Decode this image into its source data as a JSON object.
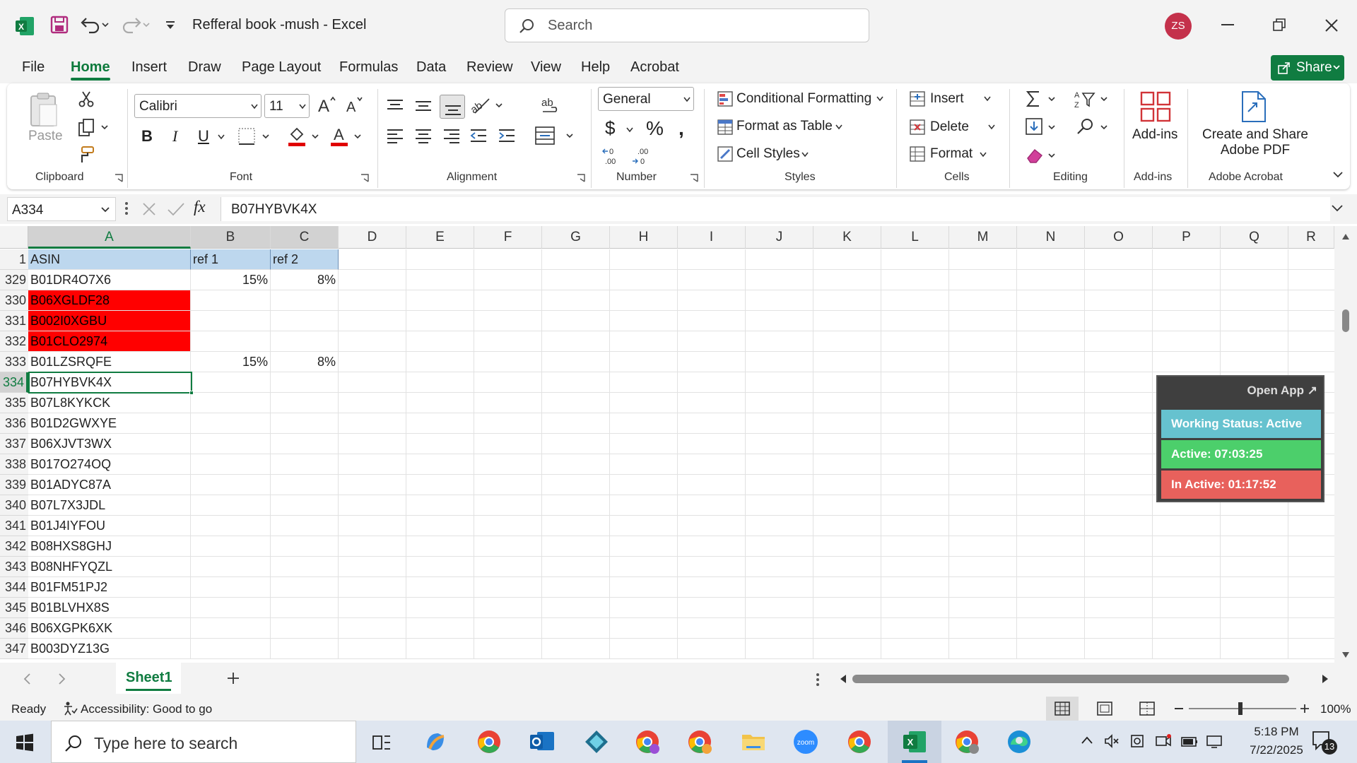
{
  "titlebar": {
    "doc_title": "Refferal book -mush  -  Excel",
    "search_placeholder": "Search",
    "avatar_initials": "ZS"
  },
  "tabs": [
    "File",
    "Home",
    "Insert",
    "Draw",
    "Page Layout",
    "Formulas",
    "Data",
    "Review",
    "View",
    "Help",
    "Acrobat"
  ],
  "share_label": "Share",
  "ribbon": {
    "clipboard": {
      "paste": "Paste",
      "group": "Clipboard"
    },
    "font": {
      "name": "Calibri",
      "size": "11",
      "group": "Font"
    },
    "alignment": {
      "group": "Alignment"
    },
    "number": {
      "format": "General",
      "group": "Number"
    },
    "styles": {
      "conditional": "Conditional Formatting",
      "table": "Format as Table",
      "cell": "Cell Styles",
      "group": "Styles"
    },
    "cells": {
      "insert": "Insert",
      "delete": "Delete",
      "format": "Format",
      "group": "Cells"
    },
    "editing": {
      "group": "Editing"
    },
    "addins": {
      "label": "Add-ins",
      "group": "Add-ins"
    },
    "acrobat": {
      "line1": "Create and Share",
      "line2": "Adobe PDF",
      "group": "Adobe Acrobat"
    }
  },
  "formula": {
    "namebox": "A334",
    "fx": "fx",
    "value": "B07HYBVK4X"
  },
  "columns": [
    "A",
    "B",
    "C",
    "D",
    "E",
    "F",
    "G",
    "H",
    "I",
    "J",
    "K",
    "L",
    "M",
    "N",
    "O",
    "P",
    "Q",
    "R"
  ],
  "header_row": {
    "num": "1",
    "a": "ASIN",
    "b": "ref 1",
    "c": "ref 2"
  },
  "rows": [
    {
      "num": "329",
      "a": "B01DR4O7X6",
      "b": "15%",
      "c": "8%",
      "red": false
    },
    {
      "num": "330",
      "a": "B06XGLDF28",
      "b": "",
      "c": "",
      "red": true
    },
    {
      "num": "331",
      "a": "B002I0XGBU",
      "b": "",
      "c": "",
      "red": true
    },
    {
      "num": "332",
      "a": "B01CLO2974",
      "b": "",
      "c": "",
      "red": true
    },
    {
      "num": "333",
      "a": "B01LZSRQFE",
      "b": "15%",
      "c": "8%",
      "red": false
    },
    {
      "num": "334",
      "a": "B07HYBVK4X",
      "b": "",
      "c": "",
      "red": false
    },
    {
      "num": "335",
      "a": "B07L8KYKCK",
      "b": "",
      "c": "",
      "red": false
    },
    {
      "num": "336",
      "a": "B01D2GWXYE",
      "b": "",
      "c": "",
      "red": false
    },
    {
      "num": "337",
      "a": "B06XJVT3WX",
      "b": "",
      "c": "",
      "red": false
    },
    {
      "num": "338",
      "a": "B017O274OQ",
      "b": "",
      "c": "",
      "red": false
    },
    {
      "num": "339",
      "a": "B01ADYC87A",
      "b": "",
      "c": "",
      "red": false
    },
    {
      "num": "340",
      "a": "B07L7X3JDL",
      "b": "",
      "c": "",
      "red": false
    },
    {
      "num": "341",
      "a": "B01J4IYFOU",
      "b": "",
      "c": "",
      "red": false
    },
    {
      "num": "342",
      "a": "B08HXS8GHJ",
      "b": "",
      "c": "",
      "red": false
    },
    {
      "num": "343",
      "a": "B08NHFYQZL",
      "b": "",
      "c": "",
      "red": false
    },
    {
      "num": "344",
      "a": "B01FM51PJ2",
      "b": "",
      "c": "",
      "red": false
    },
    {
      "num": "345",
      "a": "B01BLVHX8S",
      "b": "",
      "c": "",
      "red": false
    },
    {
      "num": "346",
      "a": "B06XGPK6XK",
      "b": "",
      "c": "",
      "red": false
    },
    {
      "num": "347",
      "a": "B003DYZ13G",
      "b": "",
      "c": "",
      "red": false
    }
  ],
  "overlay": {
    "open_app": "Open App ↗",
    "working": "Working Status: Active",
    "active": "Active: 07:03:25",
    "inactive": "In Active: 01:17:52"
  },
  "sheet_tab": "Sheet1",
  "status": {
    "ready": "Ready",
    "accessibility": "Accessibility: Good to go",
    "zoom": "100%"
  },
  "taskbar": {
    "search_placeholder": "Type here to search",
    "time": "5:18 PM",
    "date": "7/22/2025",
    "notifications": "13"
  },
  "colors": {
    "excel_green": "#107c41",
    "red_fill": "#ff0000",
    "header_fill": "#bdd7ee",
    "overlay_blue": "#66c2cf",
    "overlay_green": "#4ccf6b",
    "overlay_red": "#e8615c"
  }
}
